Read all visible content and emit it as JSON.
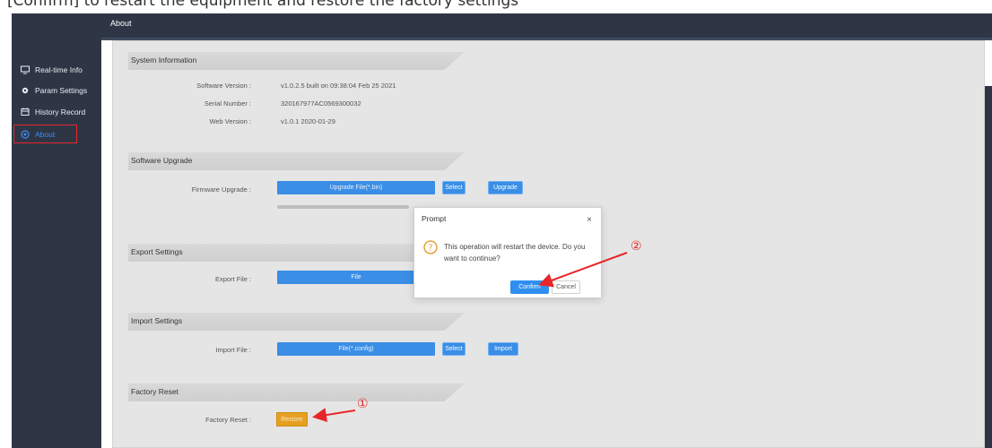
{
  "caption": "[Confirm] to restart the equipment and restore the factory settings",
  "header": {
    "title": "About"
  },
  "sidebar": {
    "items": [
      {
        "label": "Real-time Info",
        "icon": "monitor-icon"
      },
      {
        "label": "Param Settings",
        "icon": "gear-icon"
      },
      {
        "label": "History Record",
        "icon": "history-icon"
      },
      {
        "label": "About",
        "icon": "info-icon"
      }
    ],
    "active": "About"
  },
  "sections": {
    "system_info": {
      "title": "System Information",
      "software_version_label": "Software Version :",
      "software_version": "v1.0.2.5 built on 09:38:04 Feb 25 2021",
      "serial_number_label": "Serial Number :",
      "serial_number": "320167977AC0569300032",
      "web_version_label": "Web Version :",
      "web_version": "v1.0.1 2020-01-29"
    },
    "software_upgrade": {
      "title": "Software Upgrade",
      "firmware_label": "Firmware Upgrade :",
      "file_button": "Upgrade File(*.bin)",
      "select_button": "Select",
      "upgrade_button": "Upgrade"
    },
    "export_settings": {
      "title": "Export Settings",
      "export_label": "Export File :",
      "file_button": "File"
    },
    "import_settings": {
      "title": "Import Settings",
      "import_label": "Import File :",
      "file_button": "File(*.config)",
      "select_button": "Select",
      "import_button": "Import"
    },
    "factory_reset": {
      "title": "Factory Reset",
      "reset_label": "Factory Reset :",
      "restore_button": "Restore"
    }
  },
  "modal": {
    "title": "Prompt",
    "close": "×",
    "message": "This operation will restart the device. Do you want to continue?",
    "confirm": "Confirm",
    "cancel": "Cancel"
  },
  "annotations": {
    "step1": "①",
    "step2": "②"
  },
  "colors": {
    "sidebar_bg": "#2e3646",
    "accent_blue": "#3a8ee6",
    "restore_orange": "#e6a020",
    "annotation_red": "#e8262a"
  }
}
